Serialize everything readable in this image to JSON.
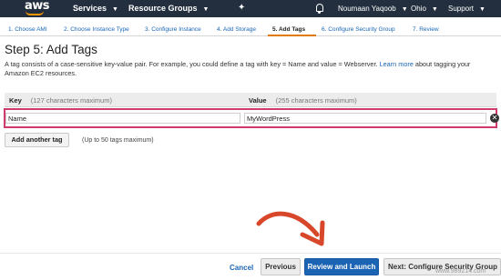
{
  "nav": {
    "logo": "aws",
    "services": "Services",
    "resource_groups": "Resource Groups",
    "user": "Noumaan Yaqoob",
    "region": "Ohio",
    "support": "Support"
  },
  "steps": [
    {
      "label": "1. Choose AMI"
    },
    {
      "label": "2. Choose Instance Type"
    },
    {
      "label": "3. Configure Instance"
    },
    {
      "label": "4. Add Storage"
    },
    {
      "label": "5. Add Tags"
    },
    {
      "label": "6. Configure Security Group"
    },
    {
      "label": "7. Review"
    }
  ],
  "page": {
    "title": "Step 5: Add Tags",
    "desc_line1": "A tag consists of a case-sensitive key-value pair. For example, you could define a tag with key = Name and value = Webserver.",
    "learn_more": "Learn more",
    "desc_line1_end": " about tagging your",
    "desc_line2": "Amazon EC2 resources."
  },
  "table": {
    "key_header": "Key",
    "key_hint": "(127 characters maximum)",
    "value_header": "Value",
    "value_hint": "(255 characters maximum)",
    "row": {
      "key": "Name",
      "value": "MyWordPress"
    },
    "remove_icon": "✕"
  },
  "add_tag": {
    "button": "Add another tag",
    "hint": "(Up to 50 tags maximum)"
  },
  "footer": {
    "cancel": "Cancel",
    "previous": "Previous",
    "review": "Review and Launch",
    "next": "Next: Configure Security Group"
  },
  "watermark": "www.989214.com",
  "colors": {
    "nav_bg": "#232f3e",
    "accent_orange": "#ff9900",
    "highlight_border": "#cf3b6b",
    "primary_button": "#1b64b4",
    "link": "#1a66b5",
    "arrow": "#d9472b"
  }
}
